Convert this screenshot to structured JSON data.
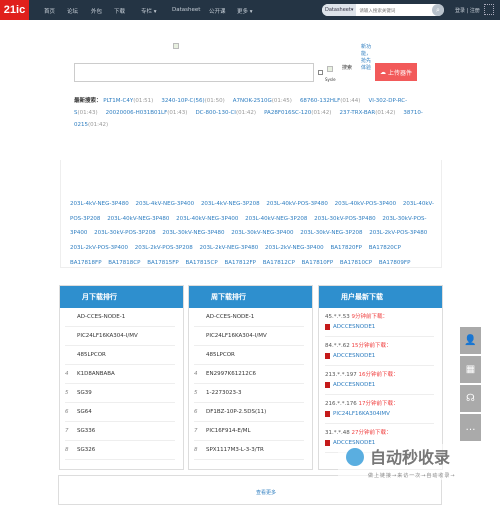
{
  "nav": {
    "logo": "21ic",
    "items": [
      "首页",
      "论坛",
      "外包",
      "下载",
      "专栏 ▾",
      "Datasheet",
      "公开课",
      "更多 ▾"
    ],
    "search_select": "Datasheet▾",
    "search_placeholder": "请输入搜索关键词",
    "login": "登录 | 注册"
  },
  "search": {
    "submit_alt": "搜索",
    "new_feature": "新功能，抢先体验",
    "upload_label": "上传器件",
    "img_alt": "Sysle"
  },
  "hot": {
    "label": "最新搜索：",
    "items": [
      {
        "name": "PLT1M-C4Y",
        "time": "(01:51)"
      },
      {
        "name": "3240-10P-C(56)",
        "time": "(01:50)"
      },
      {
        "name": "A7NOK-2510G",
        "time": "(01:45)"
      },
      {
        "name": "68760-132HLF",
        "time": "(01:44)"
      },
      {
        "name": "VI-302-DP-RC-S",
        "time": "(01:43)"
      },
      {
        "name": "20020006-H031B01LF",
        "time": "(01:43)"
      },
      {
        "name": "DC-800-130-CI",
        "time": "(01:42)"
      },
      {
        "name": "PA28F016SC-120",
        "time": "(01:42)"
      },
      {
        "name": "237-TRX-BAR",
        "time": "(01:42)"
      },
      {
        "name": "38710-0215",
        "time": "(01:42)"
      }
    ]
  },
  "links": [
    "203L-4kV-NEG-3P480",
    "203L-4kV-NEG-3P400",
    "203L-4kV-NEG-3P208",
    "203L-40kV-POS-3P480",
    "203L-40kV-POS-3P400",
    "203L-40kV-POS-3P208",
    "203L-40kV-NEG-3P480",
    "203L-40kV-NEG-3P400",
    "203L-40kV-NEG-3P208",
    "203L-30kV-POS-3P480",
    "203L-30kV-POS-3P400",
    "203L-30kV-POS-3P208",
    "203L-30kV-NEG-3P480",
    "203L-30kV-NEG-3P400",
    "203L-30kV-NEG-3P208",
    "203L-2kV-POS-3P480",
    "203L-2kV-POS-3P400",
    "203L-2kV-POS-3P208",
    "203L-2kV-NEG-3P480",
    "203L-2kV-NEG-3P400",
    "BA17820FP",
    "BA17820CP",
    "BA17818FP",
    "BA17818CP",
    "BA17815FP",
    "BA17815CP",
    "BA17812FP",
    "BA17812CP",
    "BA17810FP",
    "BA17810CP",
    "BA17809FP"
  ],
  "monthly": {
    "title": "月下载排行",
    "rows": [
      {
        "n": "",
        "name": "AD-CCES-NODE-1"
      },
      {
        "n": "",
        "name": "PIC24LF16KA304-I/MV"
      },
      {
        "n": "",
        "name": "485LPCOR"
      },
      {
        "n": "4",
        "name": "K1D8ANBABA"
      },
      {
        "n": "5",
        "name": "SG39"
      },
      {
        "n": "6",
        "name": "SG64"
      },
      {
        "n": "7",
        "name": "SG336"
      },
      {
        "n": "8",
        "name": "SG326"
      }
    ]
  },
  "weekly": {
    "title": "周下载排行",
    "rows": [
      {
        "n": "",
        "name": "AD-CCES-NODE-1"
      },
      {
        "n": "",
        "name": "PIC24LF16KA304-I/MV"
      },
      {
        "n": "",
        "name": "485LPCOR"
      },
      {
        "n": "4",
        "name": "EN2997K61212C6"
      },
      {
        "n": "5",
        "name": "1-2273023-3"
      },
      {
        "n": "6",
        "name": "DF1BZ-10P-2.5DS(11)"
      },
      {
        "n": "7",
        "name": "PIC16F914-E/ML"
      },
      {
        "n": "8",
        "name": "SPX1117M3-L-3-3/TR"
      }
    ]
  },
  "recent": {
    "title": "用户最新下载",
    "rows": [
      {
        "ip": "45.*.*.53",
        "time": "9分钟前下载：",
        "file": "ADCCESNODE1"
      },
      {
        "ip": "84.*.*.62",
        "time": "15分钟前下载：",
        "file": "ADCCESNODE1"
      },
      {
        "ip": "213.*.*.197",
        "time": "16分钟前下载：",
        "file": "ADCCESNODE1"
      },
      {
        "ip": "216.*.*.176",
        "time": "17分钟前下载：",
        "file": "PIC24LF16KA304IMV"
      },
      {
        "ip": "31.*.*.48",
        "time": "27分钟前下载：",
        "file": "ADCCESNODE1"
      }
    ]
  },
  "more_label": "查看更多",
  "watermark": {
    "title": "自动秒收录",
    "subtitle": "做上链接→来访一次→自动收录→"
  }
}
